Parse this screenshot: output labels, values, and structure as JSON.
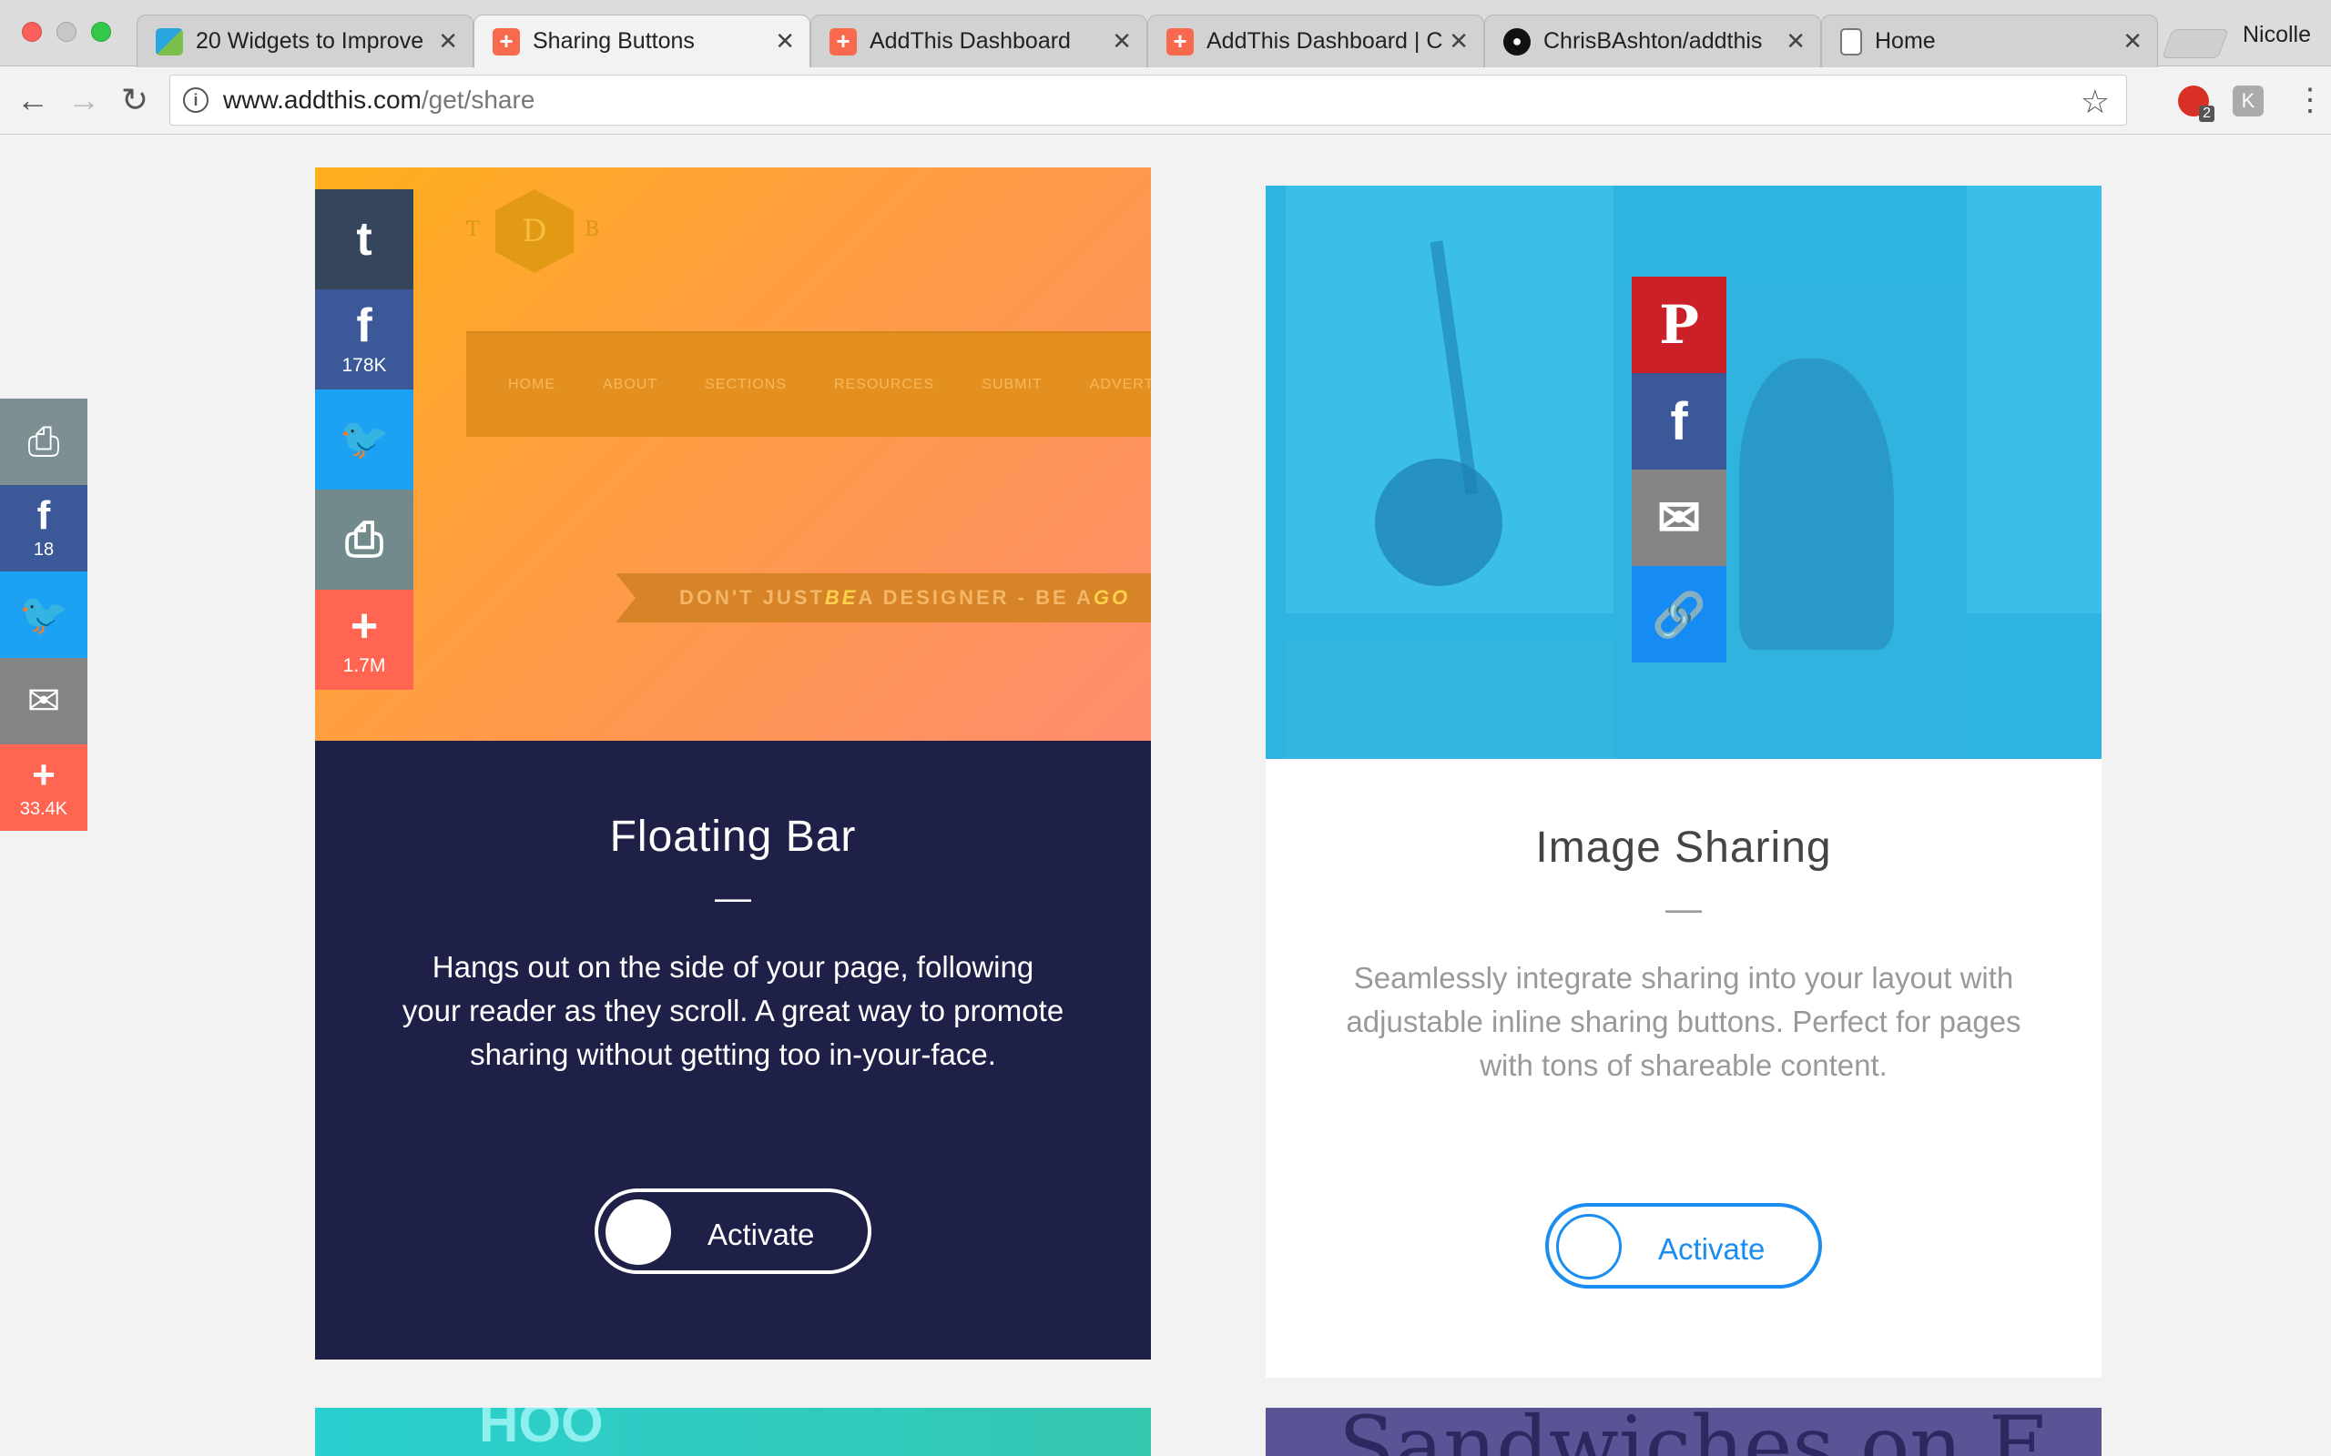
{
  "browser": {
    "tabs": [
      {
        "title": "20 Widgets to Improve",
        "icon": "widget-icon",
        "color": "#2a8c3c"
      },
      {
        "title": "Sharing Buttons",
        "icon": "addthis-icon",
        "color": "#f8694d"
      },
      {
        "title": "AddThis Dashboard",
        "icon": "addthis-icon",
        "color": "#f8694d"
      },
      {
        "title": "AddThis Dashboard | C",
        "icon": "addthis-icon",
        "color": "#f8694d"
      },
      {
        "title": "ChrisBAshton/addthis",
        "icon": "github-icon",
        "color": "#111111"
      },
      {
        "title": "Home",
        "icon": "page-icon",
        "color": "#777777"
      }
    ],
    "user": "Nicolle",
    "url_host": "www.addthis.com",
    "url_path": "/get/share",
    "extension_badge": "2"
  },
  "left_sidebar": {
    "items": [
      {
        "icon": "print-icon",
        "glyph": "⎙",
        "count": "",
        "color": "#7d8f93"
      },
      {
        "icon": "facebook-icon",
        "glyph": "f",
        "count": "18",
        "color": "#3b5998"
      },
      {
        "icon": "twitter-icon",
        "glyph": "🐦",
        "count": "",
        "color": "#1da1f2"
      },
      {
        "icon": "email-icon",
        "glyph": "✉",
        "count": "",
        "color": "#848484"
      },
      {
        "icon": "more-icon",
        "glyph": "+",
        "count": "33.4K",
        "color": "#ff6550"
      }
    ]
  },
  "floating_bar_card": {
    "title": "Floating Bar",
    "dash": "—",
    "description": "Hangs out on the side of your page, following your reader as they scroll. A great way to promote sharing without getting too in-your-face.",
    "toggle_label": "Activate",
    "preview": {
      "logo_letters": [
        "T",
        "D",
        "B"
      ],
      "nav": [
        "HOME",
        "ABOUT",
        "SECTIONS",
        "RESOURCES",
        "SUBMIT",
        "ADVERTIS"
      ],
      "ribbon_a": "DON'T JUST ",
      "ribbon_em1": "BE",
      "ribbon_b": " A DESIGNER - BE A ",
      "ribbon_em2": "GO",
      "bar": [
        {
          "icon": "tumblr-icon",
          "glyph": "t",
          "count": "",
          "color": "#35465c"
        },
        {
          "icon": "facebook-icon",
          "glyph": "f",
          "count": "178K",
          "color": "#3b5998"
        },
        {
          "icon": "twitter-icon",
          "glyph": "🐦",
          "count": "",
          "color": "#1da1f2"
        },
        {
          "icon": "print-icon",
          "glyph": "⎙",
          "count": "",
          "color": "#738a8d"
        },
        {
          "icon": "more-icon",
          "glyph": "+",
          "count": "1.7M",
          "color": "#ff6550"
        }
      ]
    }
  },
  "image_sharing_card": {
    "title": "Image Sharing",
    "dash": "—",
    "description": "Seamlessly integrate sharing into your layout with adjustable inline sharing buttons. Perfect for pages with tons of shareable content.",
    "toggle_label": "Activate",
    "bar": [
      {
        "icon": "pinterest-icon",
        "glyph": "P",
        "color": "#cb2027"
      },
      {
        "icon": "facebook-icon",
        "glyph": "f",
        "color": "#3b5998"
      },
      {
        "icon": "email-icon",
        "glyph": "✉",
        "color": "#848484"
      },
      {
        "icon": "link-icon",
        "glyph": "🔗",
        "color": "#178bf4"
      }
    ]
  },
  "more_cards": {
    "left_snippet": "HOO",
    "right_snippet": "Sandwiches on F"
  }
}
